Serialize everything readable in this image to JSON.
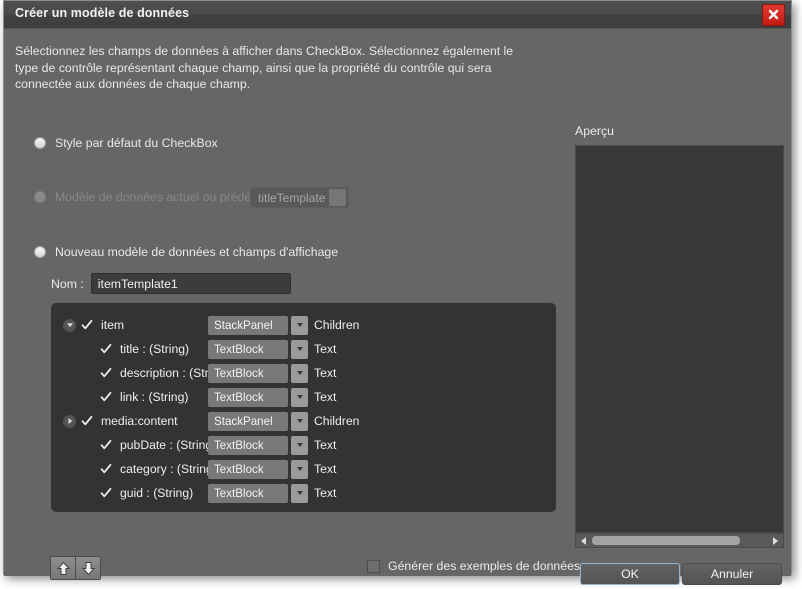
{
  "window": {
    "title": "Créer un modèle de données",
    "close_icon": "close-x-icon"
  },
  "description": "Sélectionnez les champs de données à afficher dans CheckBox. Sélectionnez également le type de contrôle représentant chaque champ, ainsi que la propriété du contrôle qui sera connectée aux données de chaque champ.",
  "options": {
    "default_style": "Style par défaut du CheckBox",
    "existing_template": "Modèle de données actuel ou prédéfini :",
    "existing_template_value": "titleTemplate",
    "new_template": "Nouveau modèle de données et champs d'affichage"
  },
  "name_field": {
    "label": "Nom :",
    "value": "itemTemplate1"
  },
  "tree": {
    "rows": [
      {
        "indent": 0,
        "expander": "down",
        "checked": true,
        "name": "item",
        "control": "StackPanel",
        "property": "Children"
      },
      {
        "indent": 1,
        "expander": "none",
        "checked": true,
        "name": "title : (String)",
        "control": "TextBlock",
        "property": "Text"
      },
      {
        "indent": 1,
        "expander": "none",
        "checked": true,
        "name": "description : (String)",
        "control": "TextBlock",
        "property": "Text"
      },
      {
        "indent": 1,
        "expander": "none",
        "checked": true,
        "name": "link : (String)",
        "control": "TextBlock",
        "property": "Text"
      },
      {
        "indent": 0,
        "expander": "right",
        "checked": true,
        "name": "media:content",
        "control": "StackPanel",
        "property": "Children"
      },
      {
        "indent": 1,
        "expander": "none",
        "checked": true,
        "name": "pubDate : (String)",
        "control": "TextBlock",
        "property": "Text"
      },
      {
        "indent": 1,
        "expander": "none",
        "checked": true,
        "name": "category : (String)",
        "control": "TextBlock",
        "property": "Text"
      },
      {
        "indent": 1,
        "expander": "none",
        "checked": true,
        "name": "guid : (String)",
        "control": "TextBlock",
        "property": "Text"
      }
    ]
  },
  "move_buttons": {
    "up_icon": "arrow-up-icon",
    "down_icon": "arrow-down-icon"
  },
  "generate_sample": {
    "label": "Générer des exemples de données",
    "checked": false
  },
  "preview": {
    "label": "Aperçu",
    "scrollbar_left_icon": "arrow-left-icon",
    "scrollbar_right_icon": "arrow-right-icon"
  },
  "buttons": {
    "ok": "OK",
    "cancel": "Annuler"
  },
  "colors": {
    "dialog_bg": "#666666",
    "titlebar_bg": "#454545",
    "tree_bg": "#333333",
    "preview_bg": "#383838",
    "close_red": "#cc1f16",
    "focus_blue": "#8fb7d4"
  }
}
